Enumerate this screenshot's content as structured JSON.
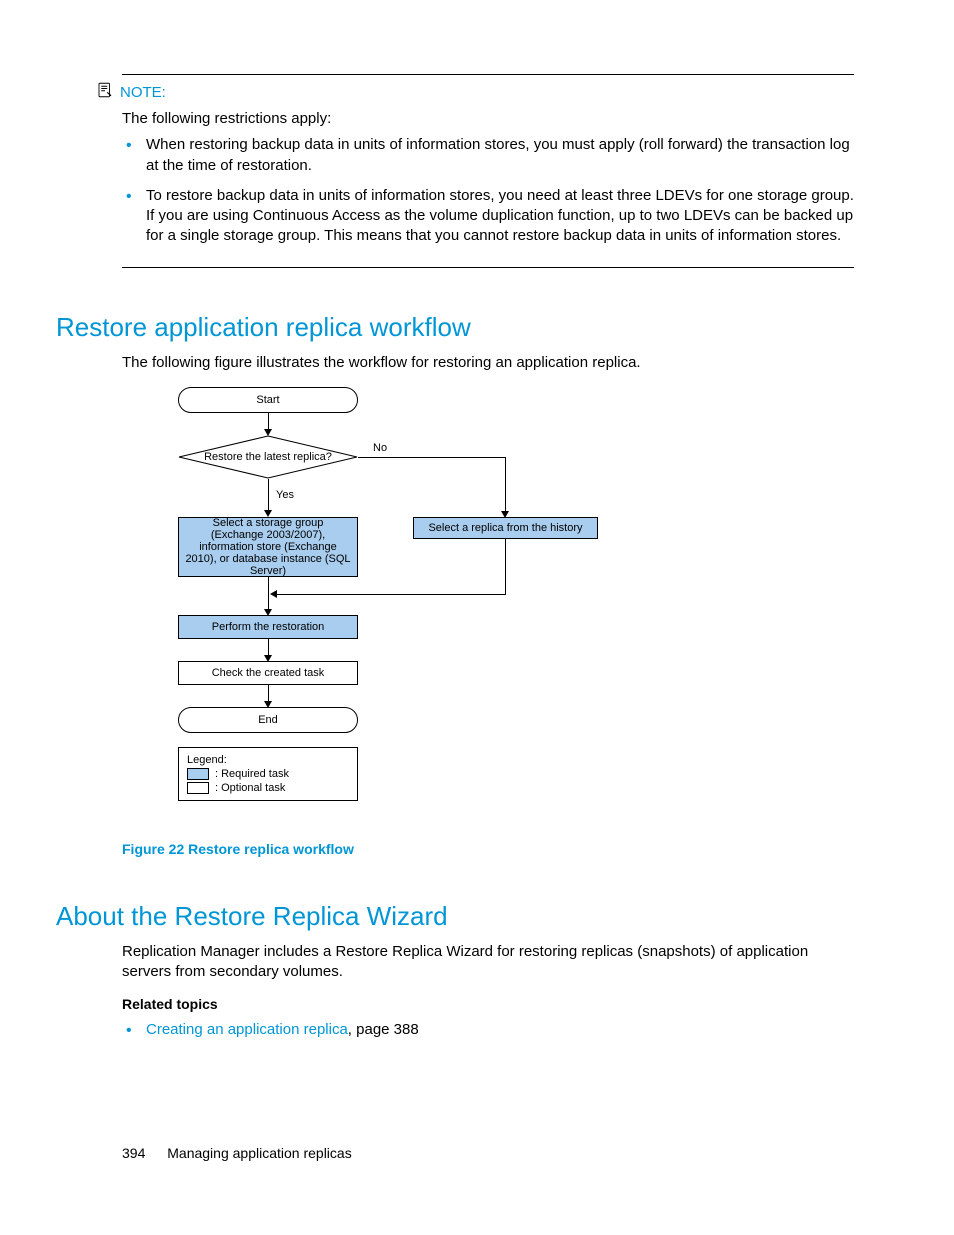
{
  "note": {
    "label": "NOTE:",
    "intro": "The following restrictions apply:",
    "bullets": [
      "When restoring backup data in units of information stores, you must apply (roll forward) the transaction log at the time of restoration.",
      "To restore backup data in units of information stores, you need at least three LDEVs for one storage group. If you are using Continuous Access as the volume duplication function, up to two LDEVs can be backed up for a single storage group. This means that you cannot restore backup data in units of information stores."
    ]
  },
  "section1": {
    "title": "Restore application replica workflow",
    "intro": "The following figure illustrates the workflow for restoring an application replica."
  },
  "flow": {
    "start": "Start",
    "decision": "Restore the latest replica?",
    "no": "No",
    "yes": "Yes",
    "select_group": "Select a storage group (Exchange 2003/2007), information store (Exchange 2010), or database instance (SQL Server)",
    "select_history": "Select a replica from the history",
    "perform": "Perform the restoration",
    "check": "Check the created task",
    "end": "End",
    "legend_title": "Legend:",
    "legend_req": ": Required task",
    "legend_opt": ": Optional  task"
  },
  "figure_caption": "Figure 22 Restore replica workflow",
  "section2": {
    "title": "About the Restore Replica Wizard",
    "body": "Replication Manager includes a Restore Replica Wizard for restoring replicas (snapshots) of application servers from secondary volumes.",
    "related_title": "Related topics",
    "related_link": "Creating an application replica",
    "related_suffix": ", page 388"
  },
  "footer": {
    "page": "394",
    "title": "Managing application replicas"
  }
}
